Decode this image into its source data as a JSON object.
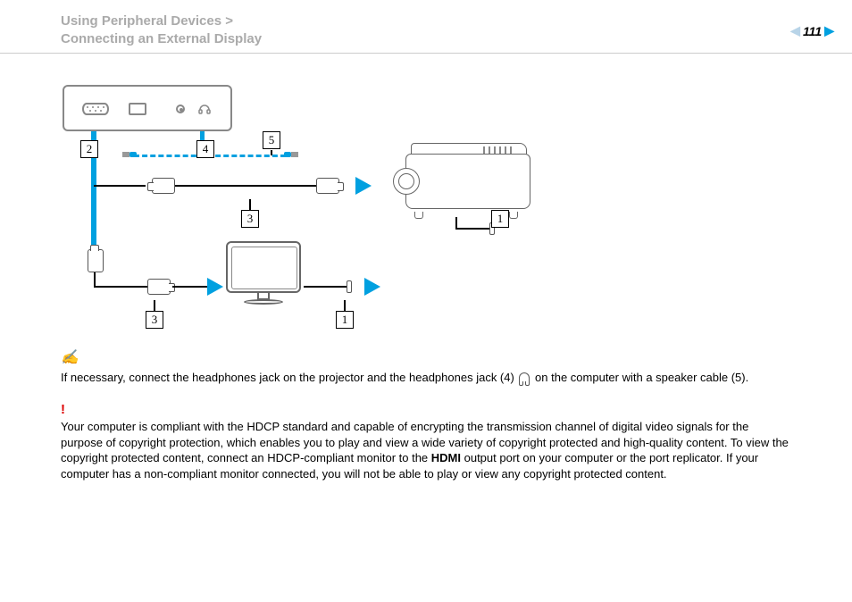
{
  "header": {
    "line1": "Using Peripheral Devices >",
    "line2": "Connecting an External Display",
    "page_number": "111"
  },
  "diagram": {
    "callouts": {
      "c2": "2",
      "c4": "4",
      "c5": "5",
      "c3a": "3",
      "c3b": "3",
      "c1a": "1",
      "c1b": "1"
    }
  },
  "note": {
    "text_before_icon": "If necessary, connect the headphones jack on the projector and the headphones jack (4) ",
    "text_after_icon": " on the computer with a speaker cable (5)."
  },
  "caution": {
    "part1": "Your computer is compliant with the HDCP standard and capable of encrypting the transmission channel of digital video signals for the purpose of copyright protection, which enables you to play and view a wide variety of copyright protected and high-quality content. To view the copyright protected content, connect an HDCP-compliant monitor to the ",
    "bold": "HDMI",
    "part2": " output port on your computer or the port replicator. If your computer has a non-compliant monitor connected, you will not be able to play or view any copyright protected content."
  }
}
